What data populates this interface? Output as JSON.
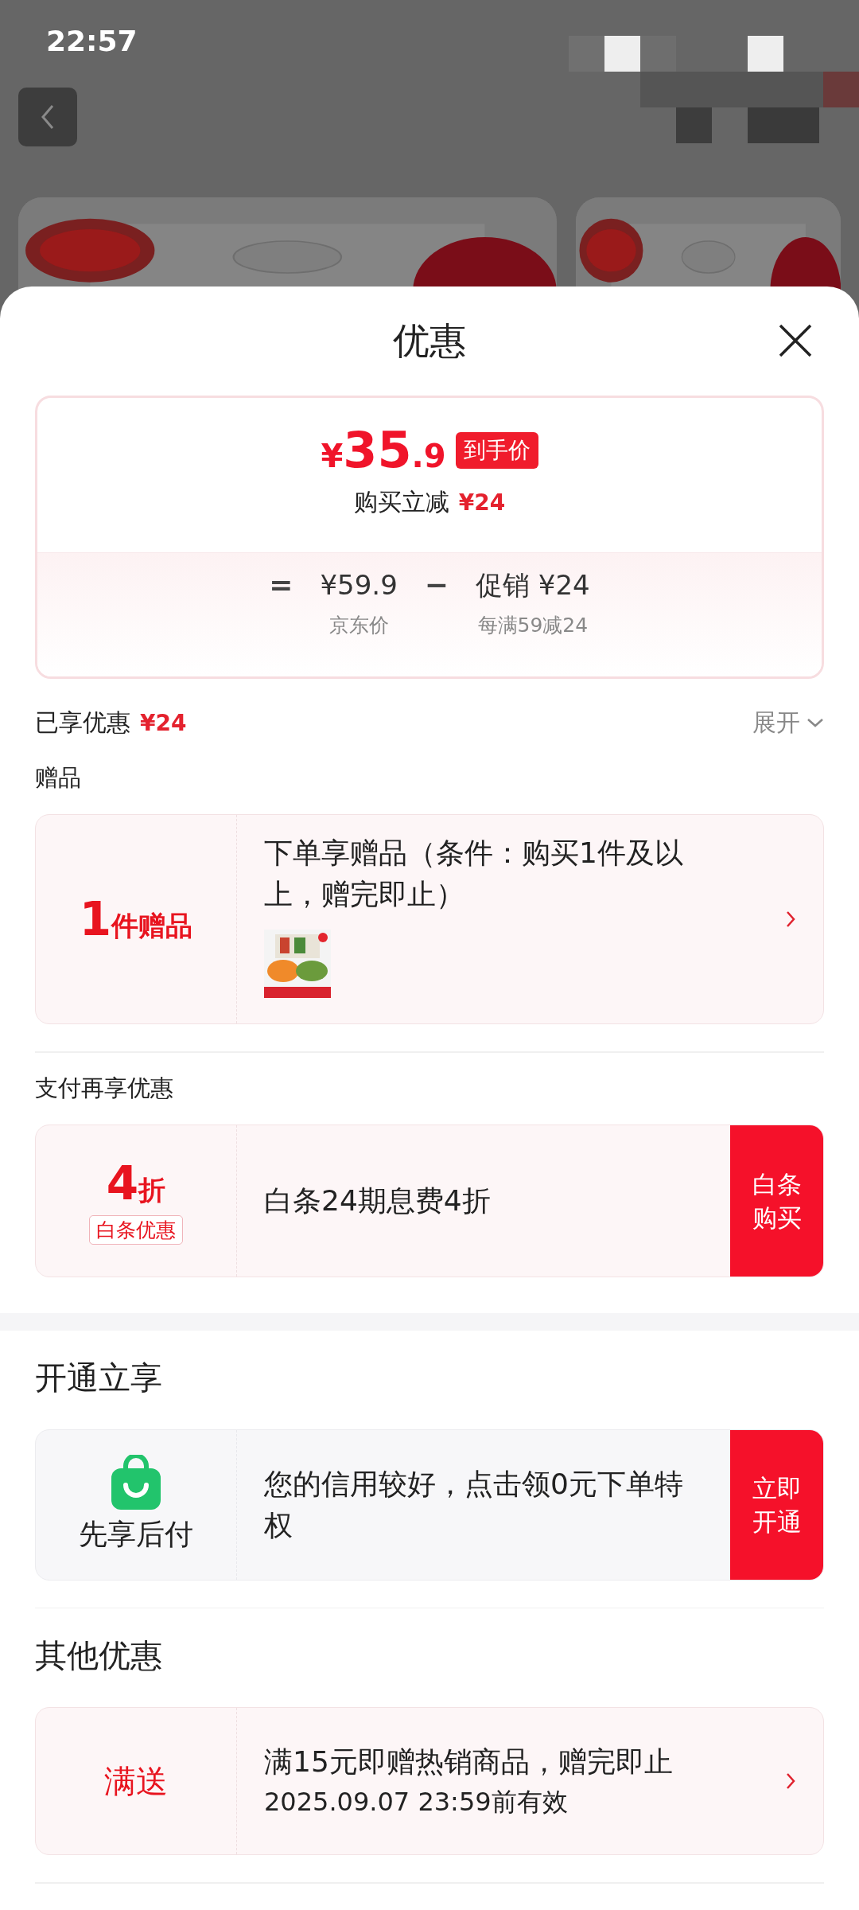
{
  "status_bar": {
    "time": "22:57"
  },
  "sheet": {
    "title": "优惠"
  },
  "price_summary": {
    "currency": "¥",
    "price_integer": "35",
    "price_decimal": ".9",
    "price_tag": "到手价",
    "instant_label": "购买立减",
    "instant_amount": "¥24",
    "breakdown": [
      {
        "kind": "operator",
        "text": "="
      },
      {
        "kind": "amount",
        "value": "¥59.9",
        "caption": "京东价"
      },
      {
        "kind": "operator",
        "text": "−"
      },
      {
        "kind": "amount",
        "value": "促销 ¥24",
        "caption": "每满59减24"
      }
    ]
  },
  "enjoyed": {
    "label": "已享优惠",
    "amount": "¥24",
    "toggle": "展开",
    "expanded": false
  },
  "sections": [
    {
      "kind": "minor",
      "title": "赠品",
      "thick_divider": false,
      "cards": [
        {
          "kind": "gift",
          "badge_main": "1",
          "badge_unit": "件赠品",
          "text": "下单享赠品（条件：购买1件及以上，赠完即止）"
        }
      ]
    },
    {
      "kind": "minor",
      "title": "支付再享优惠",
      "thick_divider": true,
      "cards": [
        {
          "kind": "discount",
          "badge_main": "4",
          "badge_unit": "折",
          "tag": "白条优惠",
          "text": "白条24期息费4折",
          "action": "白条购买"
        }
      ]
    },
    {
      "kind": "major",
      "title": "开通立享",
      "thick_divider": false,
      "cards": [
        {
          "kind": "service",
          "label": "先享后付",
          "text": "您的信用较好，点击领0元下单特权",
          "action": "立即开通"
        }
      ]
    },
    {
      "kind": "major",
      "title": "其他优惠",
      "thick_divider": false,
      "cards": [
        {
          "kind": "promo",
          "label": "满送",
          "text": "满15元即赠热销商品，赠完即止",
          "subtext": "2025.09.07 23:59前有效"
        }
      ]
    }
  ]
}
